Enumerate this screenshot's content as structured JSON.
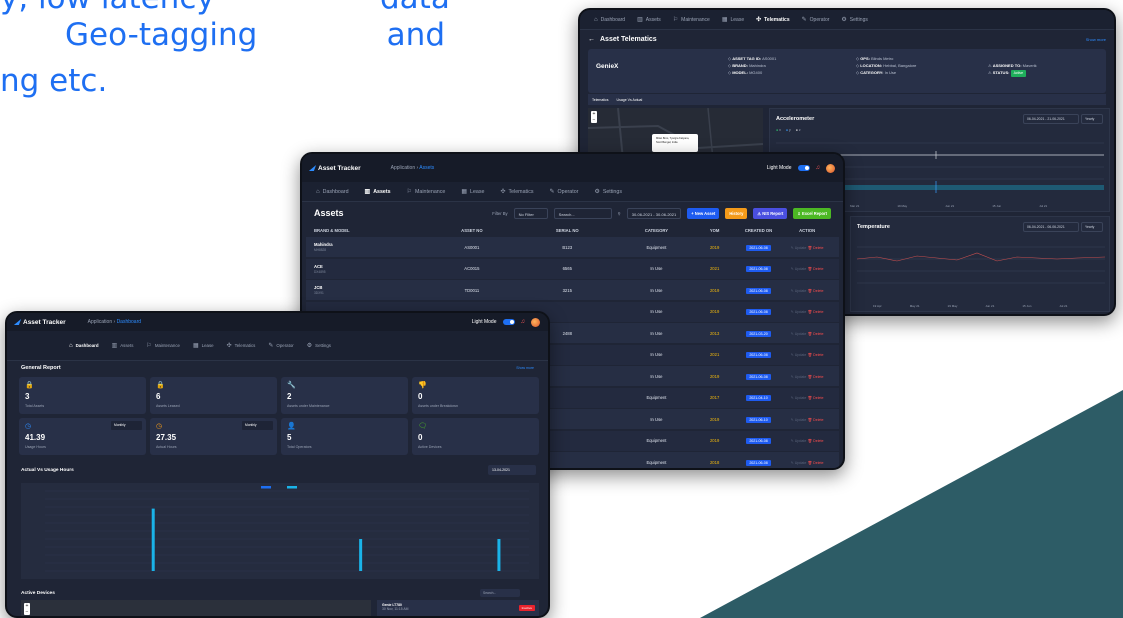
{
  "headline": {
    "line1_a": "y, low latency",
    "line1_b": "data",
    "line2_a": "Geo-tagging",
    "line2_b": "and",
    "line3": "ng etc."
  },
  "colors": {
    "accent": "#1e6ff2",
    "shape": "#2d5c66",
    "screen_bg": "#1f2536"
  },
  "app": {
    "name": "Asset Tracker",
    "light_mode": "Light Mode"
  },
  "nav": [
    "Dashboard",
    "Assets",
    "Maintenance",
    "Lease",
    "Telematics",
    "Operator",
    "Settings"
  ],
  "telematics": {
    "title": "Asset Telematics",
    "more": "Show more",
    "asset_name": "GenieX",
    "fields": {
      "tag_label": "ASSET TAG ID:",
      "tag_value": "AS0001",
      "brand_label": "BRAND:",
      "brand_value": "Mahindra",
      "model_label": "MODEL:",
      "model_value": "MG400",
      "gps_label": "GPS:",
      "gps_value": "Blinds Metro",
      "location_label": "LOCATION:",
      "location_value": "Hebbal, Bangalore",
      "category_label": "CATEGORY:",
      "category_value": "In Use",
      "assigned_label": "ASSIGNED TO:",
      "assigned_value": "Maverik",
      "status_label": "STATUS:",
      "status_value": "Active"
    },
    "subtabs": [
      "Telematics",
      "Usage Vs Actual"
    ],
    "map_popup": "Milan Bros, Tyargra Kalyana, Nord Bengal, India",
    "accel": {
      "title": "Accelerometer",
      "date": "06-04-2021 - 21-06-2021",
      "select": "Yearly",
      "legend": [
        "x",
        "y",
        "z"
      ],
      "x_label": "Time",
      "ticks": [
        "Mar 21",
        "19 May",
        "Jun 21",
        "15 Jun",
        "Jul 21"
      ]
    },
    "temp": {
      "title": "Temperature",
      "date": "06-04-2021 - 06-06-2021",
      "select": "Yearly",
      "x_label": "Time",
      "y_label": "Temp",
      "ticks": [
        "19 Apr",
        "May 21",
        "19 May",
        "Jun 21",
        "15 Jun",
        "Jul 21"
      ]
    }
  },
  "assets": {
    "breadcrumb_app": "Application",
    "breadcrumb_page": "Assets",
    "title": "Assets",
    "filter_label": "Filter By",
    "filter_value": "No Filter",
    "search_placeholder": "Search...",
    "date_range": "30-06-2021 - 30-06-2021",
    "btn_new": "+ New Asset",
    "btn_history": "History",
    "btn_nis": "NIS Report",
    "btn_excel": "Excel Report",
    "columns": [
      "BRAND & MODEL",
      "ASSET NO",
      "SERIAL NO",
      "CATEGORY",
      "YOM",
      "CREATED ON",
      "ACTION"
    ],
    "update_label": "Update",
    "delete_label": "Delete",
    "rows": [
      {
        "brand": "Mahindra",
        "model": "MH8828",
        "asset": "AS0001",
        "serial": "B123",
        "category": "Equipment",
        "yom": "2019",
        "created": "2021-06-08"
      },
      {
        "brand": "ACE",
        "model": "DX4895",
        "asset": "AC0015",
        "serial": "6565",
        "category": "In Use",
        "yom": "2021",
        "created": "2021-06-08"
      },
      {
        "brand": "JCB",
        "model": "3DX91",
        "asset": "TD0011",
        "serial": "3215",
        "category": "In Use",
        "yom": "2019",
        "created": "2021-06-08"
      },
      {
        "brand": "",
        "model": "",
        "asset": "",
        "serial": "",
        "category": "In Use",
        "yom": "2019",
        "created": "2021-06-08"
      },
      {
        "brand": "",
        "model": "",
        "asset": "",
        "serial": "2488",
        "category": "In Use",
        "yom": "2013",
        "created": "2021-03-20"
      },
      {
        "brand": "",
        "model": "",
        "asset": "",
        "serial": "",
        "category": "In Use",
        "yom": "2021",
        "created": "2021-06-08"
      },
      {
        "brand": "",
        "model": "",
        "asset": "",
        "serial": "",
        "category": "In Use",
        "yom": "2019",
        "created": "2021-06-08"
      },
      {
        "brand": "",
        "model": "",
        "asset": "",
        "serial": "",
        "category": "Equipment",
        "yom": "2017",
        "created": "2021-04-10"
      },
      {
        "brand": "",
        "model": "",
        "asset": "",
        "serial": "",
        "category": "In Use",
        "yom": "2019",
        "created": "2021-06-10"
      },
      {
        "brand": "",
        "model": "",
        "asset": "",
        "serial": "",
        "category": "Equipment",
        "yom": "2019",
        "created": "2021-06-08"
      },
      {
        "brand": "",
        "model": "",
        "asset": "",
        "serial": "",
        "category": "Equipment",
        "yom": "2018",
        "created": "2021-06-08"
      }
    ]
  },
  "dashboard": {
    "breadcrumb_app": "Application",
    "breadcrumb_page": "Dashboard",
    "section_title": "General Report",
    "section_more": "Show more",
    "cards": [
      {
        "icon": "lock-icon",
        "glyph": "🔒",
        "color": "#f39a1a",
        "value": "3",
        "label": "Total Assets"
      },
      {
        "icon": "lock-icon",
        "glyph": "🔒",
        "color": "#4cb824",
        "value": "6",
        "label": "Assets Leased"
      },
      {
        "icon": "wrench-icon",
        "glyph": "🔧",
        "color": "#4cb824",
        "value": "2",
        "label": "Assets under Maintenance"
      },
      {
        "icon": "thumbs-down-icon",
        "glyph": "👎",
        "color": "#f2b90c",
        "value": "0",
        "label": "Assets under Breakdown"
      },
      {
        "icon": "clock-icon",
        "glyph": "◷",
        "color": "#2d8cff",
        "value": "41.39",
        "label": "Usage Hours",
        "select": "Monthly"
      },
      {
        "icon": "clock-icon",
        "glyph": "◷",
        "color": "#f39a1a",
        "value": "27.35",
        "label": "Actual Hours",
        "select": "Monthly"
      },
      {
        "icon": "user-icon",
        "glyph": "👤",
        "color": "#f39a1a",
        "value": "5",
        "label": "Total Operators"
      },
      {
        "icon": "chat-icon",
        "glyph": "🗨",
        "color": "#4cb824",
        "value": "0",
        "label": "Active Devices"
      }
    ],
    "chart_title": "Actual Vs Usage Hours",
    "chart_date": "13-04-2021",
    "devices_title": "Active Devices",
    "devices_search": "Search...",
    "device_name": "Genie LT780",
    "device_sub": "30 Nov, 11:15 AM",
    "device_status": "Inactive"
  },
  "chart_data": {
    "type": "bar",
    "categories": [
      "1",
      "2",
      "3",
      "4",
      "5",
      "6",
      "7"
    ],
    "series": [
      {
        "values": [
          0,
          0,
          0,
          0,
          0,
          0,
          0
        ]
      },
      {
        "values": [
          0,
          78,
          0,
          0,
          40,
          0,
          40
        ]
      }
    ],
    "ylim": [
      0,
      100
    ]
  }
}
